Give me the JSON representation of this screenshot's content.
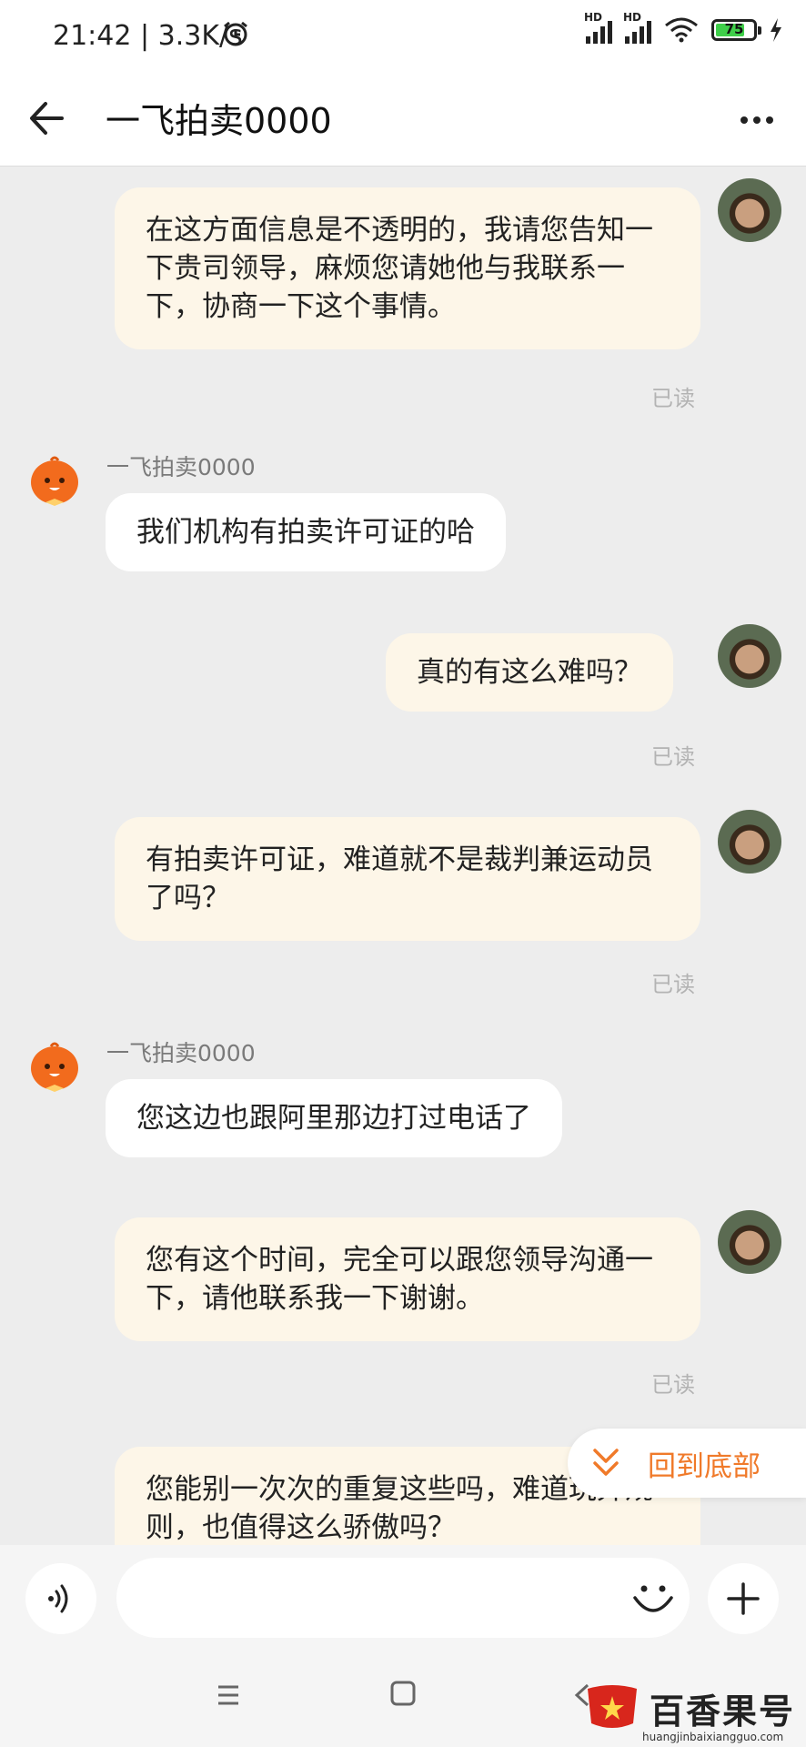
{
  "status_bar": {
    "time": "21:42 | 3.3K/s",
    "battery": "75",
    "hd1": "HD",
    "hd2": "HD"
  },
  "header": {
    "title": "一飞拍卖0000"
  },
  "messages": [
    {
      "side": "me",
      "text": "在这方面信息是不透明的，我请您告知一下贵司领导，麻烦您请她他与我联系一下，协商一下这个事情。",
      "status": "已读"
    },
    {
      "side": "them",
      "sender": "一飞拍卖0000",
      "text": "我们机构有拍卖许可证的哈"
    },
    {
      "side": "me",
      "text": "真的有这么难吗？",
      "status": "已读"
    },
    {
      "side": "me",
      "text": "有拍卖许可证，难道就不是裁判兼运动员了吗？",
      "status": "已读"
    },
    {
      "side": "them",
      "sender": "一飞拍卖0000",
      "text": "您这边也跟阿里那边打过电话了"
    },
    {
      "side": "me",
      "text": "您有这个时间，完全可以跟您领导沟通一下，请他联系我一下谢谢。",
      "status": "已读"
    },
    {
      "side": "me",
      "text": "您能别一次次的重复这些吗，难道玩弄规则，也值得这么骄傲吗？"
    }
  ],
  "jump_to_bottom": {
    "label": "回到底部"
  },
  "input": {
    "placeholder": ""
  },
  "watermark": {
    "title": "百香果号",
    "url": "huangjinbaixiangguo.com"
  },
  "colors": {
    "accent": "#f07a2a",
    "my_bubble": "#fdf6e8",
    "their_bubble": "#ffffff",
    "background": "#ededed"
  },
  "icons": [
    "back-arrow-icon",
    "more-icon",
    "voice-icon",
    "emoji-icon",
    "plus-icon",
    "double-chevron-down-icon",
    "alarm-icon",
    "signal-icon",
    "wifi-icon",
    "battery-icon",
    "charging-icon"
  ]
}
